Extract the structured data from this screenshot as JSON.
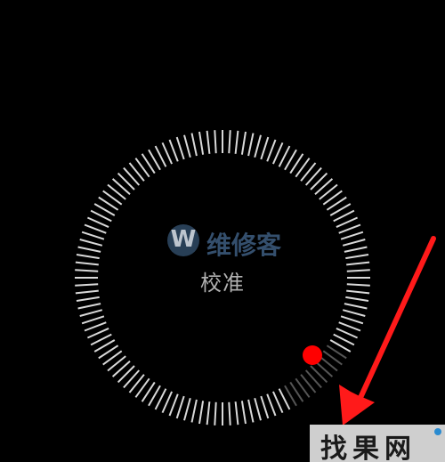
{
  "screen": {
    "calibration_label": "校准"
  },
  "dial": {
    "tick_color": "#d9d9d9",
    "indicator_color": "#ff0000",
    "indicator_icon": "red-dot-icon",
    "progress_arc_color": "#555555"
  },
  "watermark": {
    "logo_letter": "W",
    "logo_text": "维修客",
    "logo_color": "#3e5d80"
  },
  "annotation": {
    "arrow_color": "#ff1a1a",
    "arrow_icon": "red-arrow-icon"
  },
  "corner_badge": {
    "text": "找果网"
  }
}
